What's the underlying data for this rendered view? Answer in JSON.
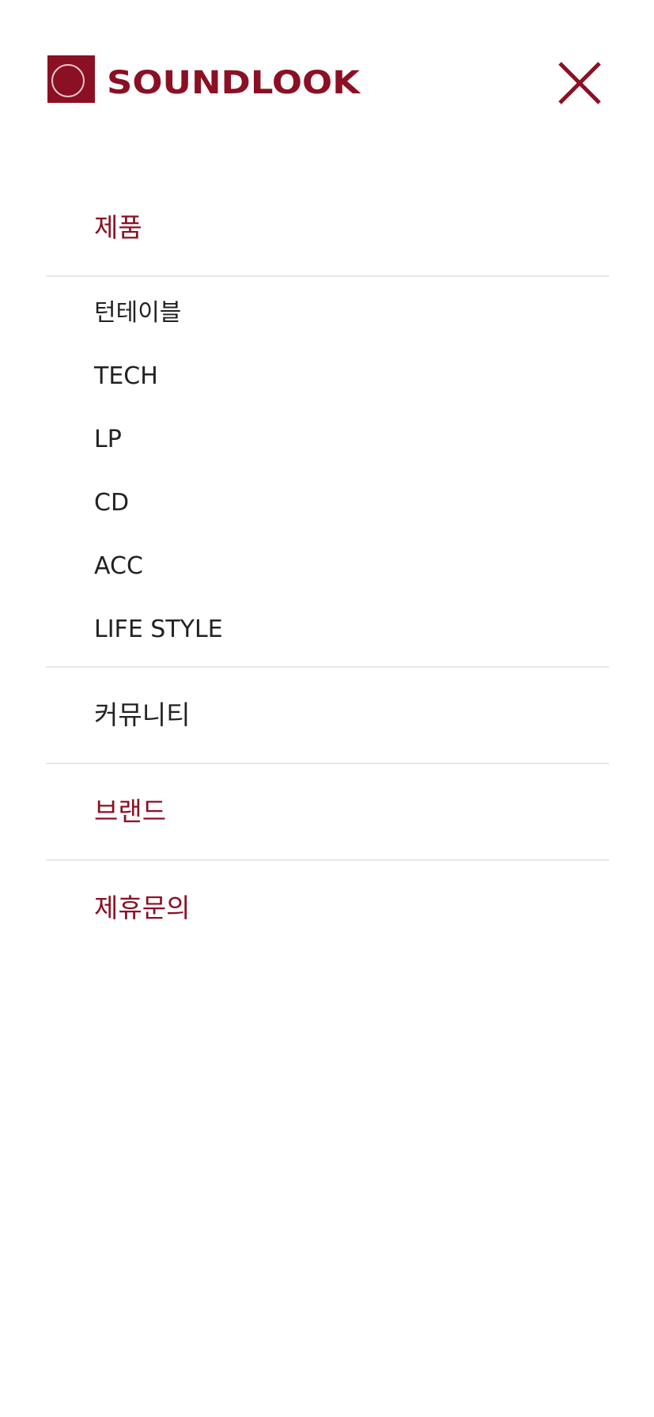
{
  "brand": {
    "logo_text": "SOUNDLOOK",
    "color": "#8b1024"
  },
  "header": {
    "close_icon": "close-icon"
  },
  "menu": {
    "products": {
      "label": "제품",
      "items": [
        {
          "label": "턴테이블"
        },
        {
          "label": "TECH"
        },
        {
          "label": "LP"
        },
        {
          "label": "CD"
        },
        {
          "label": "ACC"
        },
        {
          "label": "LIFE STYLE"
        }
      ]
    },
    "community": {
      "label": "커뮤니티"
    },
    "brand": {
      "label": "브랜드"
    },
    "partnership": {
      "label": "제휴문의"
    }
  },
  "colors": {
    "accent": "#8b1024",
    "text": "#222222",
    "divider": "#e7e7e7"
  }
}
